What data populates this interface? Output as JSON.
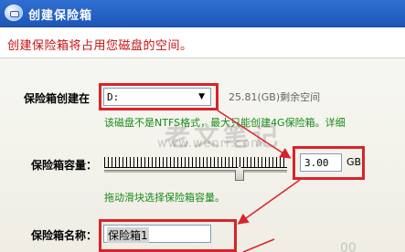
{
  "window": {
    "title": "创建保险箱"
  },
  "notice": {
    "text": "创建保险箱将占用您磁盘的空间。"
  },
  "location": {
    "label": "保险箱创建在",
    "selected_drive": "D:",
    "free_space": "25.81(GB)剩余空间",
    "hint": "该磁盘不是NTFS格式，最大只能创建4G保险箱。详细"
  },
  "capacity": {
    "label": "保险箱容量：",
    "value": "3.00",
    "unit": "GB",
    "hint": "拖动滑块选择保险箱容量。",
    "slider_fraction": 0.74
  },
  "name": {
    "label": "保险箱名称：",
    "value": "保险箱1"
  },
  "watermark": {
    "text": "老文笔记",
    "url": "www.wenrr.com",
    "corner": "00"
  },
  "colors": {
    "titlebar": "#1d57b8",
    "notice_text": "#c81010",
    "hint_text": "#178a17",
    "annotation_red": "#d9232a"
  }
}
